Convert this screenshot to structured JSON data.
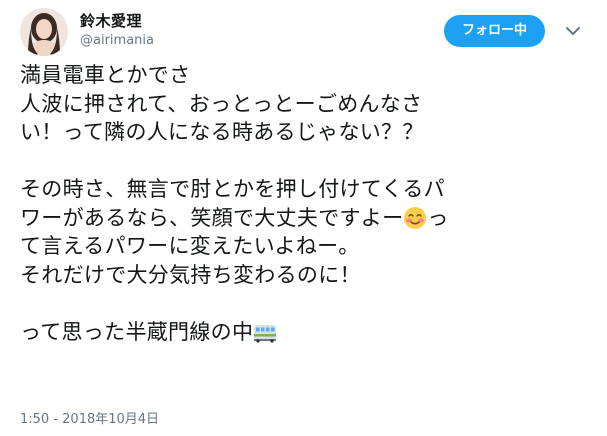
{
  "user": {
    "display_name": "鈴木愛理",
    "handle": "@airimania"
  },
  "follow_button": {
    "label": "フォロー中"
  },
  "tweet": {
    "lines": [
      "満員電車とかでさ",
      "人波に押されて、おっとっとーごめんなさ",
      "い！って隣の人になる時あるじゃない？？",
      "",
      "その時さ、無言で肘とかを押し付けてくるパ",
      "ワーがあるなら、笑顔で大丈夫ですよー",
      "て言えるパワーに変えたいよねー。",
      "それだけで大分気持ち変わるのに！",
      "",
      "って思った半蔵門線の中"
    ],
    "line6_suffix": "っ",
    "emojis": [
      "smiling-face-with-blush-emoji",
      "train-emoji"
    ]
  },
  "timestamp": "1:50 - 2018年10月4日",
  "colors": {
    "accent": "#1da1f2",
    "text": "#14171a",
    "muted": "#657786"
  }
}
